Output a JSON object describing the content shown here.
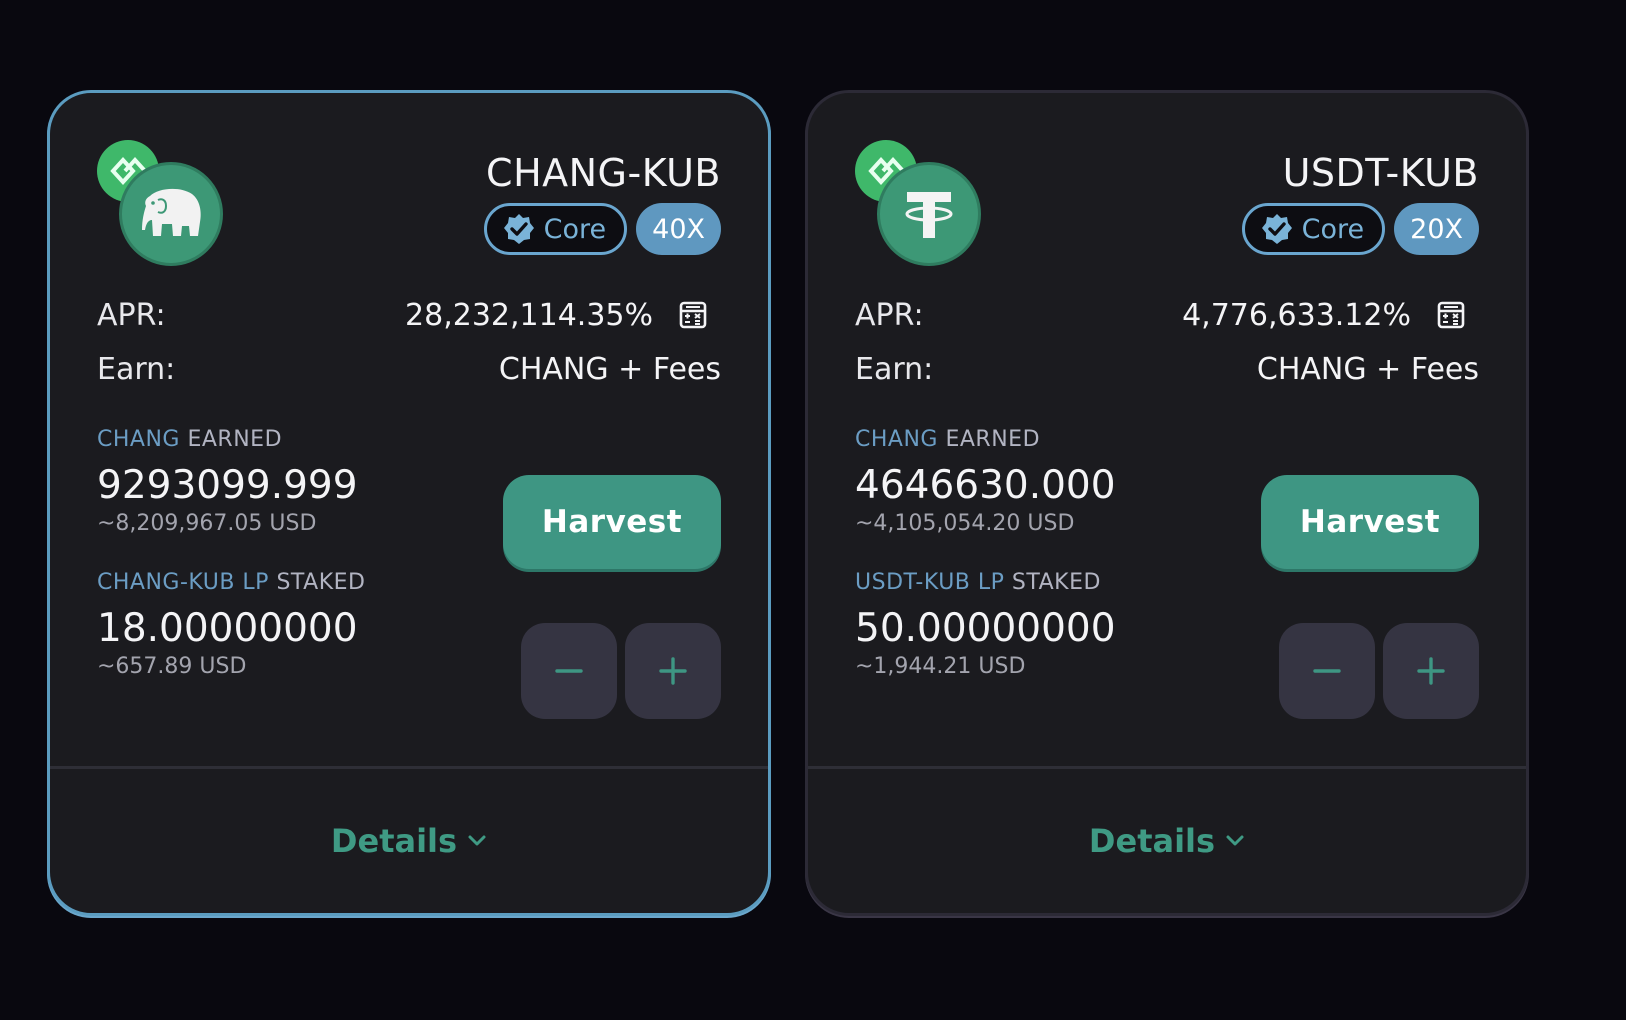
{
  "farms": [
    {
      "pair_name": "CHANG-KUB",
      "core_label": "Core",
      "multiplier": "40X",
      "apr_label": "APR:",
      "apr_value": "28,232,114.35%",
      "earn_label": "Earn:",
      "earn_value": "CHANG + Fees",
      "earned_token": "CHANG",
      "earned_suffix": "EARNED",
      "earned_amount": "9293099.999",
      "earned_usd": "~8,209,967.05 USD",
      "harvest_label": "Harvest",
      "staked_token": "CHANG-KUB LP",
      "staked_suffix": "STAKED",
      "staked_amount": "18.00000000",
      "staked_usd": "~657.89 USD",
      "minus_label": "−",
      "plus_label": "+",
      "details_label": "Details",
      "front_logo_icon": "elephant-icon",
      "back_logo_icon": "kub-chain-icon"
    },
    {
      "pair_name": "USDT-KUB",
      "core_label": "Core",
      "multiplier": "20X",
      "apr_label": "APR:",
      "apr_value": "4,776,633.12%",
      "earn_label": "Earn:",
      "earn_value": "CHANG + Fees",
      "earned_token": "CHANG",
      "earned_suffix": "EARNED",
      "earned_amount": "4646630.000",
      "earned_usd": "~4,105,054.20 USD",
      "harvest_label": "Harvest",
      "staked_token": "USDT-KUB LP",
      "staked_suffix": "STAKED",
      "staked_amount": "50.00000000",
      "staked_usd": "~1,944.21 USD",
      "minus_label": "−",
      "plus_label": "+",
      "details_label": "Details",
      "front_logo_icon": "tether-icon",
      "back_logo_icon": "kub-chain-icon"
    }
  ],
  "colors": {
    "background": "#09080f",
    "card": "#1b1b1f",
    "accent_green": "#3e9683",
    "accent_blue": "#5f98c0",
    "highlight_border": "#5b9cc0"
  }
}
